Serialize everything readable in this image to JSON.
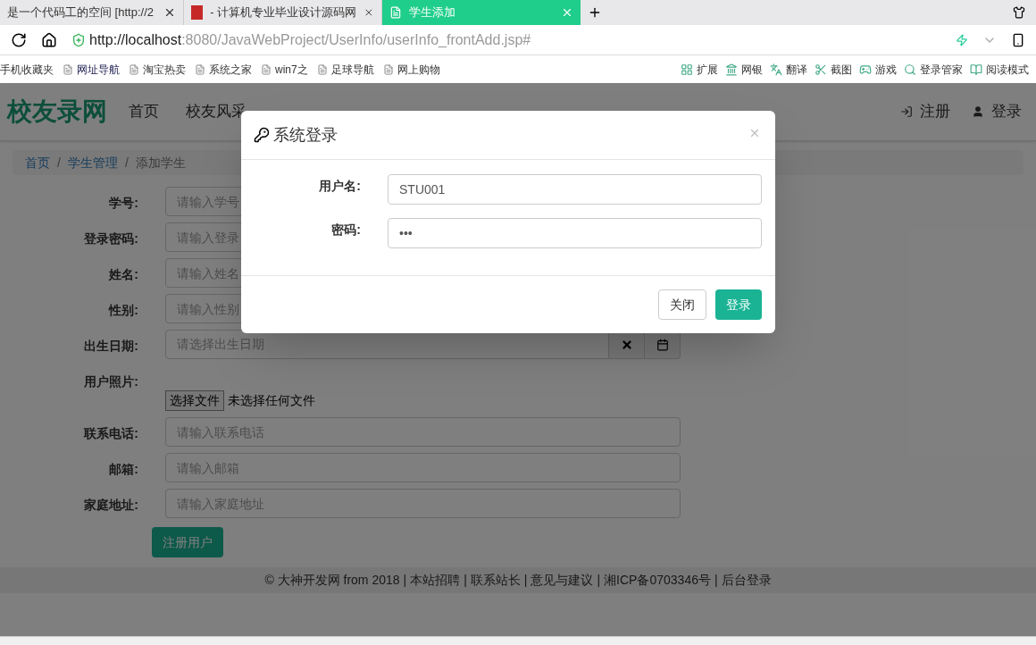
{
  "browser": {
    "tabs": [
      {
        "label": "是一个代码工的空间 [http://2",
        "selected": false
      },
      {
        "label": "- 计算机专业毕业设计源码网",
        "selected": false
      },
      {
        "label": "学生添加",
        "selected": true
      }
    ],
    "url": {
      "host": "http://localhost",
      "rest": ":8080/JavaWebProject/UserInfo/userInfo_frontAdd.jsp#"
    },
    "bookmarks": [
      {
        "label": "手机收藏夹",
        "kind": "plain"
      },
      {
        "label": "网址导航",
        "kind": "page"
      },
      {
        "label": "淘宝热卖",
        "kind": "page"
      },
      {
        "label": "系统之家",
        "kind": "page"
      },
      {
        "label": "win7之",
        "kind": "page"
      },
      {
        "label": "足球导航",
        "kind": "page"
      },
      {
        "label": "网上购物",
        "kind": "page"
      }
    ],
    "tools": [
      "扩展",
      "网银",
      "翻译",
      "截图",
      "游戏",
      "登录管家",
      "阅读模式"
    ]
  },
  "site": {
    "logo": "校友录网",
    "nav": [
      "首页",
      "校友风采"
    ],
    "register": "注册",
    "login": "登录"
  },
  "breadcrumb": {
    "items": [
      "首页",
      "学生管理",
      "添加学生"
    ],
    "separators": [
      "/",
      "/"
    ]
  },
  "form": {
    "fields": [
      {
        "label": "学号:",
        "kind": "text",
        "placeholder": "请输入学号"
      },
      {
        "label": "登录密码:",
        "kind": "text",
        "placeholder": "请输入登录"
      },
      {
        "label": "姓名:",
        "kind": "text",
        "placeholder": "请输入姓名"
      },
      {
        "label": "性别:",
        "kind": "text",
        "placeholder": "请输入性别"
      },
      {
        "label": "出生日期:",
        "kind": "date",
        "placeholder": "请选择出生日期"
      },
      {
        "label": "用户照片:",
        "kind": "file",
        "button": "选择文件",
        "status": "未选择任何文件"
      },
      {
        "label": "联系电话:",
        "kind": "text",
        "placeholder": "请输入联系电话"
      },
      {
        "label": "邮箱:",
        "kind": "text",
        "placeholder": "请输入邮箱"
      },
      {
        "label": "家庭地址:",
        "kind": "text",
        "placeholder": "请输入家庭地址"
      }
    ],
    "submit": "注册用户"
  },
  "footer": {
    "items": [
      "© 大神开发网 from 2018",
      "本站招聘",
      "联系站长",
      "意见与建议",
      "湘ICP备0703346号",
      "后台登录"
    ],
    "separators": [
      "|",
      "|",
      "|",
      "|",
      "|"
    ]
  },
  "modal": {
    "title": "系统登录",
    "fields": [
      {
        "label": "用户名:",
        "value": "STU001"
      },
      {
        "label": "密码:",
        "value": "•••"
      }
    ],
    "buttons": [
      {
        "label": "关闭",
        "kind": "default"
      },
      {
        "label": "登录",
        "kind": "primary"
      }
    ]
  }
}
